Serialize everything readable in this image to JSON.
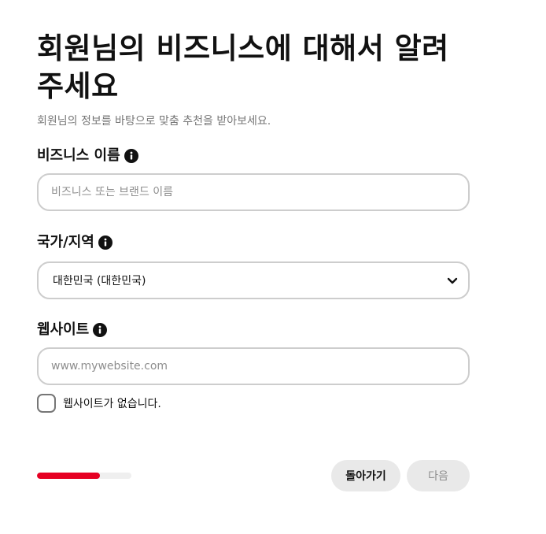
{
  "header": {
    "title_line1": "회원님의 비즈니스에 대해서 알려",
    "title_line2": "주세요",
    "subtitle": "회원님의 정보를 바탕으로 맞춤 추천을 받아보세요."
  },
  "fields": {
    "business_name": {
      "label": "비즈니스 이름",
      "placeholder": "비즈니스 또는 브랜드 이름",
      "value": ""
    },
    "country": {
      "label": "국가/지역",
      "selected": "대한민국 (대한민국)"
    },
    "website": {
      "label": "웹사이트",
      "placeholder": "www.mywebsite.com",
      "value": ""
    },
    "no_website": {
      "label": "웹사이트가 없습니다.",
      "checked": false
    }
  },
  "footer": {
    "progress": 0.67,
    "back_label": "돌아가기",
    "next_label": "다음"
  },
  "colors": {
    "accent": "#e60023",
    "border": "#cdcdcd",
    "button_bg": "#e9e9e9",
    "muted_text": "#767676"
  },
  "icons": {
    "info": "info-icon",
    "dropdown": "chevron-down-icon"
  }
}
